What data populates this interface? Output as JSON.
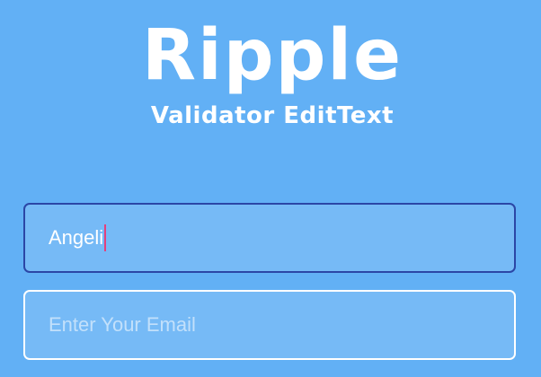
{
  "logo": {
    "title": "Ripple",
    "subtitle": "Validator EditText"
  },
  "form": {
    "name_field": {
      "value": "Angeli"
    },
    "email_field": {
      "placeholder": "Enter Your Email",
      "value": ""
    }
  },
  "colors": {
    "background": "#62b0f5",
    "field_fill": "#76baf6",
    "focused_border": "#2b46a6",
    "unfocused_border": "#ffffff",
    "caret": "#e5407c",
    "placeholder_text": "#c2e0fb"
  }
}
